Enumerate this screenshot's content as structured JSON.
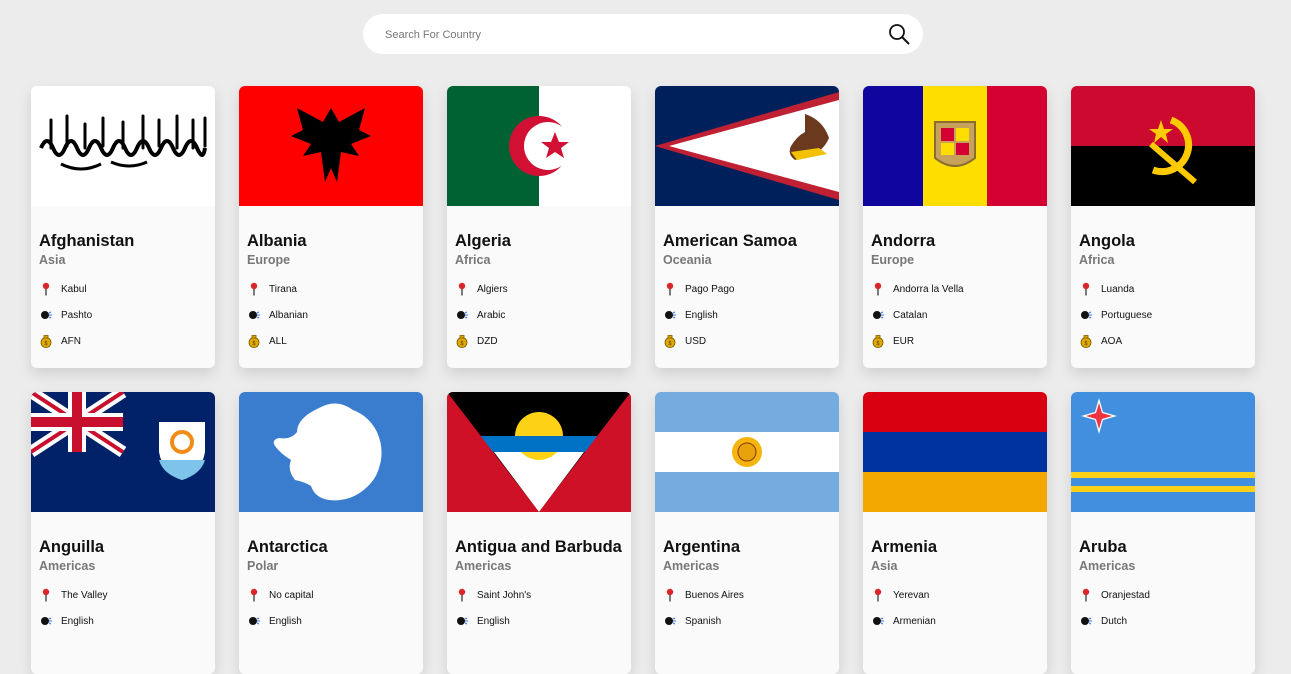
{
  "search": {
    "placeholder": "Search For Country",
    "value": ""
  },
  "icons": {
    "search": "search-icon",
    "capital": "pin-icon",
    "language": "speaking-head-icon",
    "currency": "money-bag-icon"
  },
  "countries": [
    {
      "name": "Afghanistan",
      "region": "Asia",
      "capital": "Kabul",
      "language": "Pashto",
      "currency": "AFN"
    },
    {
      "name": "Albania",
      "region": "Europe",
      "capital": "Tirana",
      "language": "Albanian",
      "currency": "ALL"
    },
    {
      "name": "Algeria",
      "region": "Africa",
      "capital": "Algiers",
      "language": "Arabic",
      "currency": "DZD"
    },
    {
      "name": "American Samoa",
      "region": "Oceania",
      "capital": "Pago Pago",
      "language": "English",
      "currency": "USD"
    },
    {
      "name": "Andorra",
      "region": "Europe",
      "capital": "Andorra la Vella",
      "language": "Catalan",
      "currency": "EUR"
    },
    {
      "name": "Angola",
      "region": "Africa",
      "capital": "Luanda",
      "language": "Portuguese",
      "currency": "AOA"
    },
    {
      "name": "Anguilla",
      "region": "Americas",
      "capital": "The Valley",
      "language": "English"
    },
    {
      "name": "Antarctica",
      "region": "Polar",
      "capital": "No capital",
      "language": "English"
    },
    {
      "name": "Antigua and Barbuda",
      "region": "Americas",
      "capital": "Saint John's",
      "language": "English"
    },
    {
      "name": "Argentina",
      "region": "Americas",
      "capital": "Buenos Aires",
      "language": "Spanish"
    },
    {
      "name": "Armenia",
      "region": "Asia",
      "capital": "Yerevan",
      "language": "Armenian"
    },
    {
      "name": "Aruba",
      "region": "Americas",
      "capital": "Oranjestad",
      "language": "Dutch"
    }
  ],
  "colors": {
    "background": "#ececec",
    "card": "#fafafa",
    "region": "#777777"
  }
}
